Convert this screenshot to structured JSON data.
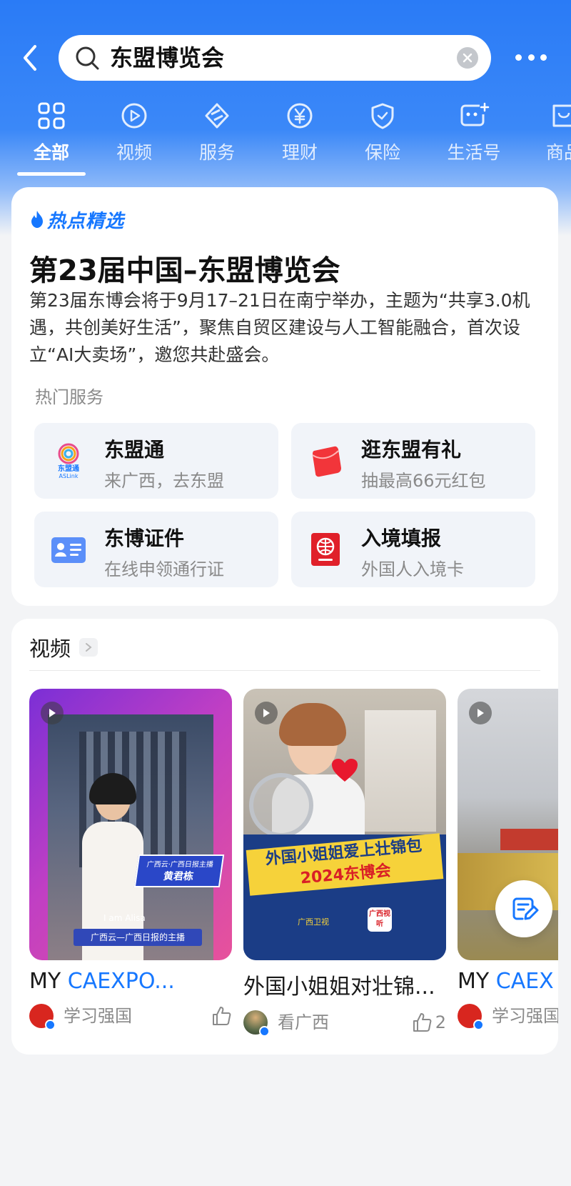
{
  "search": {
    "query": "东盟博览会",
    "back_icon": "chevron-left-icon",
    "search_icon": "search-icon",
    "clear_icon": "clear-icon",
    "more_icon": "more-icon"
  },
  "tabs": [
    {
      "label": "全部",
      "icon": "grid-icon",
      "active": true
    },
    {
      "label": "视频",
      "icon": "play-icon",
      "active": false
    },
    {
      "label": "服务",
      "icon": "layers-icon",
      "active": false
    },
    {
      "label": "理财",
      "icon": "yen-icon",
      "active": false
    },
    {
      "label": "保险",
      "icon": "shield-icon",
      "active": false
    },
    {
      "label": "生活号",
      "icon": "life-icon",
      "active": false
    },
    {
      "label": "商品",
      "icon": "shop-icon",
      "active": false
    }
  ],
  "featured": {
    "badge": "热点精选",
    "title": "第23届中国–东盟博览会",
    "description": " 第23届东博会将于9月17–21日在南宁举办，主题为“共享3.0机遇，共创美好生活”，聚焦自贸区建设与人工智能融合，首次设立“AI大卖场”，邀您共赴盛会。",
    "services_label": "热门服务",
    "services": [
      {
        "title": "东盟通",
        "subtitle": "来广西，去东盟",
        "icon": "asean-link-logo",
        "logo_text": "东盟通",
        "logo_sub": "ASLink"
      },
      {
        "title": "逛东盟有礼",
        "subtitle": "抽最高66元红包",
        "icon": "red-envelope-icon"
      },
      {
        "title": "东博证件",
        "subtitle": "在线申领通行证",
        "icon": "id-card-icon"
      },
      {
        "title": "入境填报",
        "subtitle": "外国人入境卡",
        "icon": "passport-icon"
      }
    ]
  },
  "videos_section": {
    "title": "视频",
    "arrow_icon": "chevron-right-icon",
    "videos": [
      {
        "title_prefix": "MY ",
        "title_highlight": "CAEXPO...",
        "source": "学习强国",
        "likes": "",
        "thumb_text1": "广西云·广西日报主播",
        "thumb_text2": "黄君栋",
        "thumb_text3": "I am Alisa",
        "thumb_text4": "广西云—广西日报的主播"
      },
      {
        "title_prefix": "外国小姐姐对壮锦...",
        "title_highlight": "",
        "source": "看广西",
        "likes": "2",
        "thumb_text1": "外国小姐姐爱上壮锦包",
        "thumb_text2": "2024东博会",
        "thumb_text3": "广西卫视",
        "thumb_text4": "广西视听"
      },
      {
        "title_prefix": "MY ",
        "title_highlight": "CAEX",
        "source": "学习强国",
        "likes": ""
      }
    ]
  },
  "colors": {
    "accent": "#1677ff",
    "header_blue": "#2a7bf6",
    "red": "#e02020"
  },
  "fab_icon": "edit-note-icon"
}
